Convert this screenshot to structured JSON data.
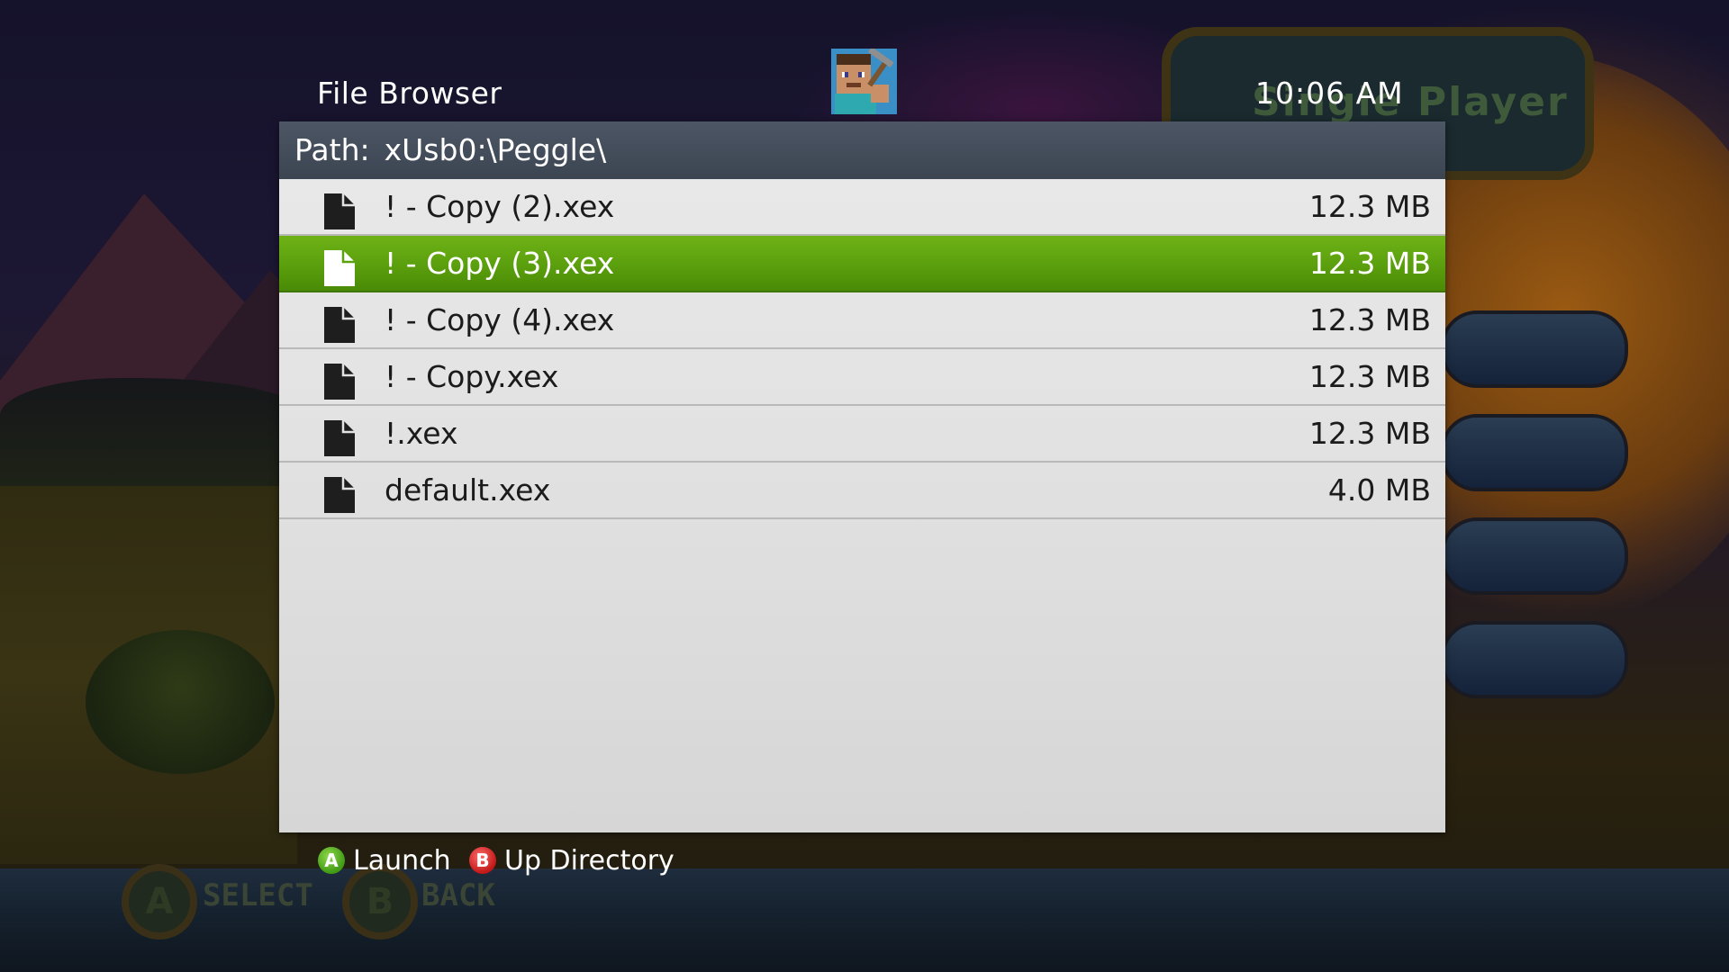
{
  "header": {
    "title": "File Browser",
    "clock": "10:06  AM",
    "avatar_icon": "minecraft-steve-avatar"
  },
  "path": {
    "label": "Path:",
    "value": "xUsb0:\\Peggle\\"
  },
  "files": [
    {
      "name": "! - Copy (2).xex",
      "size": "12.3 MB",
      "icon": "file-icon",
      "selected": false
    },
    {
      "name": "! - Copy (3).xex",
      "size": "12.3 MB",
      "icon": "file-icon",
      "selected": true
    },
    {
      "name": "! - Copy (4).xex",
      "size": "12.3 MB",
      "icon": "file-icon",
      "selected": false
    },
    {
      "name": "! - Copy.xex",
      "size": "12.3 MB",
      "icon": "file-icon",
      "selected": false
    },
    {
      "name": "!.xex",
      "size": "12.3 MB",
      "icon": "file-icon",
      "selected": false
    },
    {
      "name": "default.xex",
      "size": "4.0 MB",
      "icon": "file-icon",
      "selected": false
    }
  ],
  "hints": {
    "a_button": "A",
    "a_label": "Launch",
    "b_button": "B",
    "b_label": "Up Directory"
  },
  "background": {
    "banner_text": "Single Player",
    "select_glyph": "A",
    "select_text": "SELECT",
    "back_glyph": "B",
    "back_text": "BACK"
  },
  "colors": {
    "selection_green": "#5ca10e",
    "path_bar": "#46505d",
    "panel": "#e3e3e3"
  }
}
